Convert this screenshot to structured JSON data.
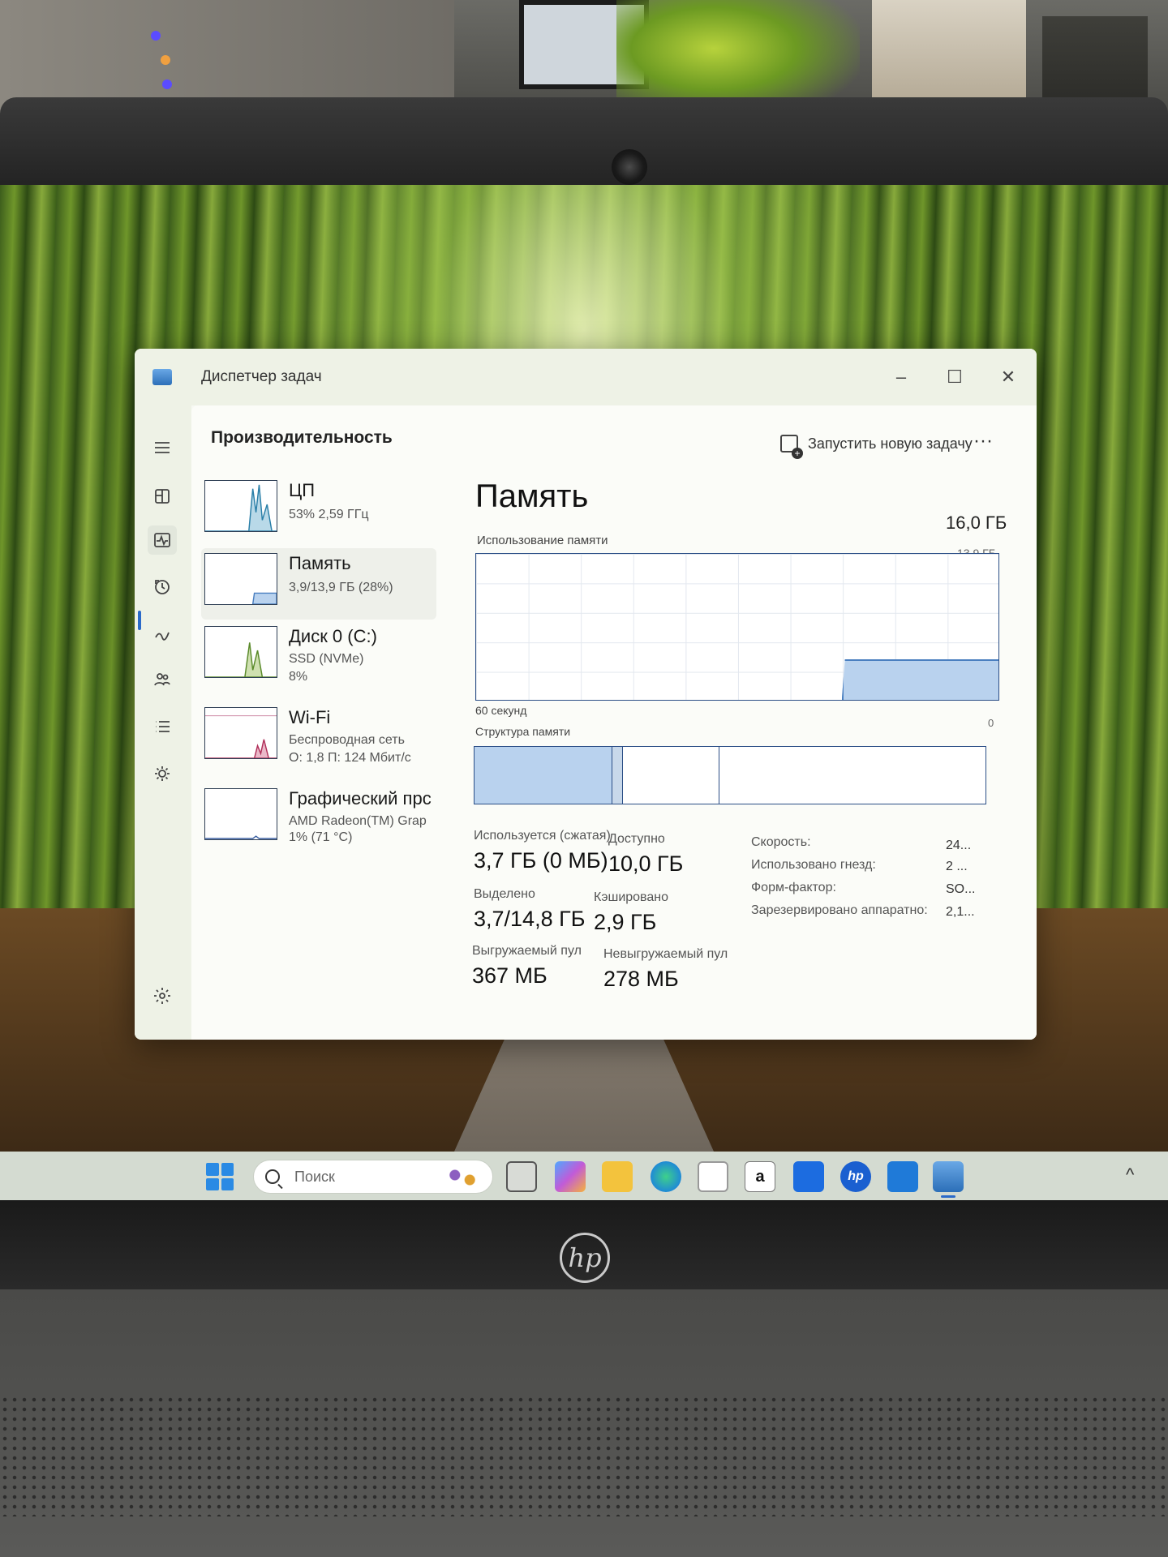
{
  "colors": {
    "accent": "#2a6ac9",
    "graph_line": "#2b4e86",
    "graph_fill": "#b9d2ee",
    "window_bg": "#f7f9f3"
  },
  "window": {
    "title": "Диспетчер задач",
    "controls": {
      "minimize": "–",
      "maximize": "☐",
      "close": "✕"
    }
  },
  "nav": {
    "items": [
      "menu-icon",
      "processes-icon",
      "performance-icon",
      "app-history-icon",
      "startup-apps-icon",
      "users-icon",
      "details-icon",
      "services-icon"
    ],
    "active": "performance-icon",
    "settings": "settings-icon"
  },
  "header": {
    "page_title": "Производительность",
    "new_task": "Запустить новую задачу",
    "more": "···"
  },
  "resources": [
    {
      "name": "ЦП",
      "sub1": "53%  2,59 ГГц",
      "sub2": "",
      "sub3": ""
    },
    {
      "name": "Память",
      "sub1": "3,9/13,9 ГБ (28%)",
      "sub2": "",
      "sub3": ""
    },
    {
      "name": "Диск 0 (C:)",
      "sub1": "SSD (NVMe)",
      "sub2": "8%",
      "sub3": ""
    },
    {
      "name": "Wi-Fi",
      "sub1": "Беспроводная сеть",
      "sub2": "О: 1,8 П: 124 Мбит/с",
      "sub3": ""
    },
    {
      "name": "Графический прс",
      "sub1": "AMD Radeon(TM) Grap",
      "sub2": "1%  (71 °C)",
      "sub3": ""
    }
  ],
  "memory": {
    "title": "Память",
    "total": "16,0 ГБ",
    "usage_label": "Использование памяти",
    "max_label": "13,9 ГБ",
    "time_label": "60 секунд",
    "zero_label": "0",
    "structure_label": "Структура памяти",
    "usage_fraction": 0.28,
    "structure": {
      "used": 0.27,
      "modified": 0.02,
      "standby": 0.19,
      "free": 0.52
    },
    "stats": {
      "in_use_label": "Используется (сжатая)",
      "in_use_value": "3,7 ГБ (0 МБ)",
      "available_label": "Доступно",
      "available_value": "10,0 ГБ",
      "committed_label": "Выделено",
      "committed_value": "3,7/14,8 ГБ",
      "cached_label": "Кэшировано",
      "cached_value": "2,9 ГБ",
      "paged_label": "Выгружаемый пул",
      "paged_value": "367 МБ",
      "nonpaged_label": "Невыгружаемый пул",
      "nonpaged_value": "278 МБ"
    },
    "specs": [
      {
        "label": "Скорость:",
        "value": "24..."
      },
      {
        "label": "Использовано гнезд:",
        "value": "2 ..."
      },
      {
        "label": "Форм-фактор:",
        "value": "SO..."
      },
      {
        "label": "Зарезервировано аппаратно:",
        "value": "2,1..."
      }
    ]
  },
  "taskbar": {
    "search_placeholder": "Поиск",
    "apps": [
      "task-view-icon",
      "copilot-icon",
      "file-explorer-icon",
      "edge-icon",
      "store-icon",
      "amazon-icon",
      "dropbox-icon",
      "hp-icon",
      "outlook-icon",
      "task-manager-icon"
    ],
    "amazon_letter": "a",
    "hp_letters": "hp",
    "tray_up": "^"
  },
  "device": {
    "brand": "hp"
  }
}
